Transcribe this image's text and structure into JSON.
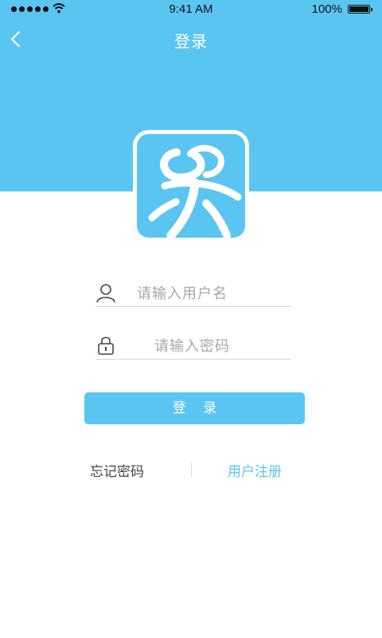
{
  "status_bar": {
    "time": "9:41 AM",
    "battery_percent": "100%"
  },
  "navbar": {
    "title": "登录"
  },
  "form": {
    "username_placeholder": "请输入用户名",
    "password_placeholder": "请输入密码",
    "login_label": "登 录"
  },
  "links": {
    "forgot_password": "忘记密码",
    "register": "用户注册"
  },
  "colors": {
    "brand": "#5bc5f2",
    "text_primary": "#444444",
    "placeholder": "#a8a8a8"
  },
  "icons": [
    "signal-icon",
    "wifi-icon",
    "battery-icon",
    "back-icon",
    "app-logo",
    "user-icon",
    "lock-icon"
  ]
}
